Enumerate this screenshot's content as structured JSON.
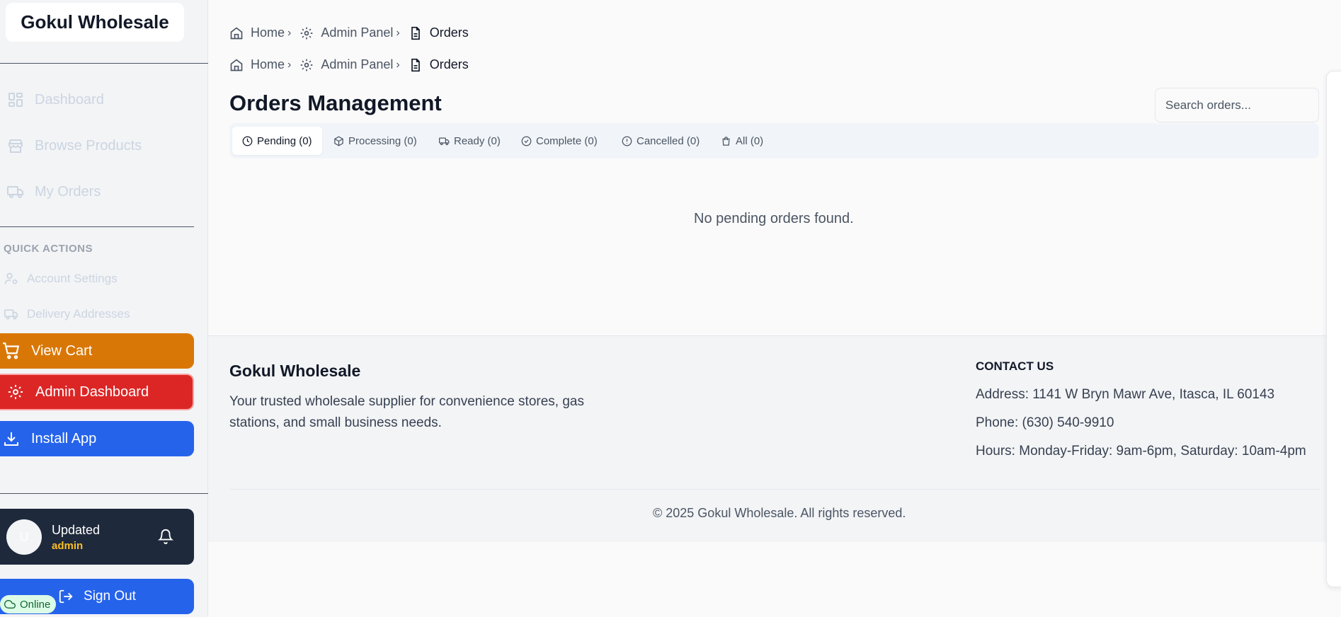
{
  "sidebar": {
    "brand": "Gokul Wholesale",
    "nav": [
      {
        "label": "Dashboard",
        "icon": "grid-icon"
      },
      {
        "label": "Browse Products",
        "icon": "store-icon"
      },
      {
        "label": "My Orders",
        "icon": "truck-icon"
      }
    ],
    "quick_actions_title": "QUICK ACTIONS",
    "quick_actions": [
      {
        "label": "Account Settings",
        "icon": "user-cog-icon"
      },
      {
        "label": "Delivery Addresses",
        "icon": "truck-icon"
      }
    ],
    "buttons": {
      "view_cart": "View Cart",
      "admin_dashboard": "Admin Dashboard",
      "install_app": "Install App"
    },
    "colors": {
      "view_cart": "#d97706",
      "admin_dashboard": "#dc2626",
      "install_app": "#2563eb"
    },
    "user": {
      "initial": "U",
      "name": "Updated",
      "role": "admin"
    },
    "sign_out": "Sign Out",
    "status": "Online"
  },
  "breadcrumbs": [
    {
      "home": "Home",
      "admin": "Admin Panel",
      "current": "Orders"
    },
    {
      "home": "Home",
      "admin": "Admin Panel",
      "current": "Orders"
    }
  ],
  "main": {
    "title": "Orders Management",
    "search_placeholder": "Search orders...",
    "tabs": [
      {
        "label": "Pending (0)",
        "icon": "clock-icon",
        "active": true
      },
      {
        "label": "Processing (0)",
        "icon": "package-icon"
      },
      {
        "label": "Ready (0)",
        "icon": "truck-icon"
      },
      {
        "label": "Complete (0)",
        "icon": "check-circle-icon"
      },
      {
        "label": "Cancelled (0)",
        "icon": "alert-circle-icon"
      },
      {
        "label": "All (0)",
        "icon": "shopping-bag-icon"
      }
    ],
    "empty_message": "No pending orders found."
  },
  "footer": {
    "brand": "Gokul Wholesale",
    "description": "Your trusted wholesale supplier for convenience stores, gas stations, and small business needs.",
    "contact_title": "CONTACT US",
    "address": "Address: 1141 W Bryn Mawr Ave, Itasca, IL 60143",
    "phone": "Phone: (630) 540-9910",
    "hours": "Hours: Monday-Friday: 9am-6pm, Saturday: 10am-4pm",
    "copyright": "© 2025 Gokul Wholesale. All rights reserved."
  }
}
